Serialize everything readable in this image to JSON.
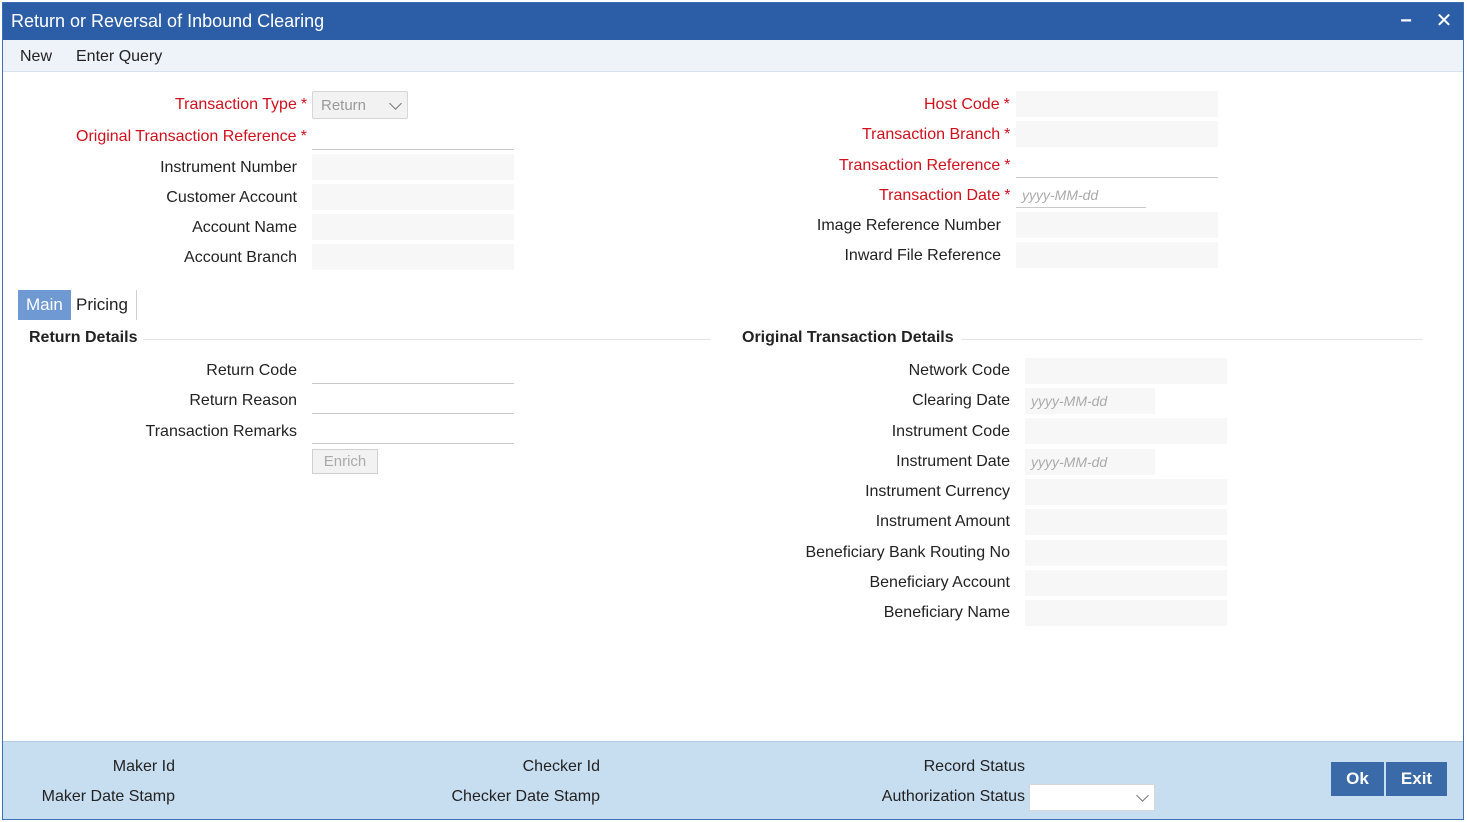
{
  "window": {
    "title": "Return or Reversal of Inbound Clearing",
    "minimize_glyph": "−",
    "close_glyph": "✕"
  },
  "menu": {
    "new": "New",
    "enter_query": "Enter Query"
  },
  "header_left": {
    "transaction_type": {
      "label": "Transaction Type",
      "value": "Return"
    },
    "original_transaction_reference": {
      "label": "Original Transaction Reference",
      "value": ""
    },
    "instrument_number": {
      "label": "Instrument Number",
      "value": ""
    },
    "customer_account": {
      "label": "Customer Account",
      "value": ""
    },
    "account_name": {
      "label": "Account Name",
      "value": ""
    },
    "account_branch": {
      "label": "Account Branch",
      "value": ""
    }
  },
  "header_right": {
    "host_code": {
      "label": "Host Code",
      "value": ""
    },
    "transaction_branch": {
      "label": "Transaction Branch",
      "value": ""
    },
    "transaction_reference": {
      "label": "Transaction Reference",
      "value": ""
    },
    "transaction_date": {
      "label": "Transaction Date",
      "placeholder": "yyyy-MM-dd"
    },
    "image_reference_number": {
      "label": "Image Reference Number",
      "value": ""
    },
    "inward_file_reference": {
      "label": "Inward File Reference",
      "value": ""
    }
  },
  "required_mark": "*",
  "tabs": [
    {
      "label": "Main",
      "active": true
    },
    {
      "label": "Pricing",
      "active": false
    }
  ],
  "return_details": {
    "title": "Return Details",
    "return_code": "Return Code",
    "return_reason": "Return Reason",
    "transaction_remarks": "Transaction Remarks",
    "enrich_button": "Enrich"
  },
  "original_details": {
    "title": "Original Transaction Details",
    "network_code": "Network Code",
    "clearing_date": "Clearing Date",
    "instrument_code": "Instrument Code",
    "instrument_date": "Instrument Date",
    "instrument_currency": "Instrument Currency",
    "instrument_amount": "Instrument Amount",
    "beneficiary_bank_routing_no": "Beneficiary Bank Routing No",
    "beneficiary_account": "Beneficiary Account",
    "beneficiary_name": "Beneficiary Name",
    "date_placeholder": "yyyy-MM-dd"
  },
  "footer": {
    "maker_id": "Maker Id",
    "maker_date_stamp": "Maker Date Stamp",
    "checker_id": "Checker Id",
    "checker_date_stamp": "Checker Date Stamp",
    "record_status": "Record Status",
    "authorization_status": "Authorization Status",
    "ok": "Ok",
    "exit": "Exit"
  },
  "colors": {
    "title_bar": "#2c5ea8",
    "required": "#d0101c",
    "tab_active": "#6f99d2",
    "footer": "#c7ddf0",
    "button": "#3a6aa8"
  }
}
